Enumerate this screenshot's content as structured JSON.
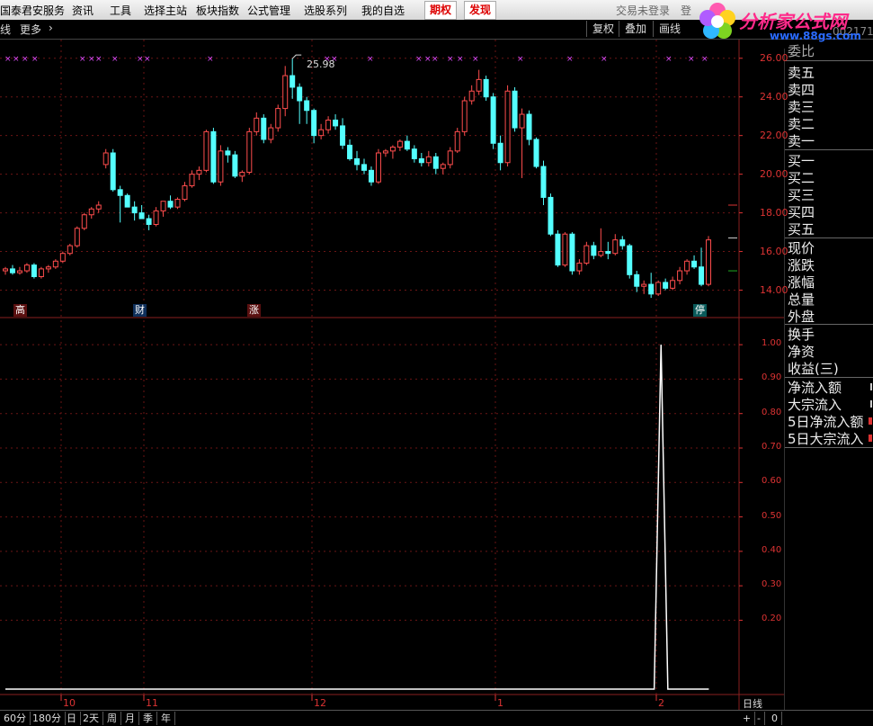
{
  "menu": {
    "items": [
      "国泰君安服务",
      "资讯",
      "工具",
      "选择主站",
      "板块指数",
      "公式管理",
      "选股系列",
      "我的自选"
    ],
    "hot_buttons": [
      "期权",
      "发现"
    ],
    "login_status": "交易未登录",
    "extra": "登"
  },
  "logo": {
    "title": "分析家公式网",
    "url": "www.88gs.com"
  },
  "toolbar": {
    "left_items": [
      "线",
      "更多"
    ],
    "buttons": [
      "复权",
      "叠加",
      "画线"
    ],
    "code": "002171"
  },
  "chart_data": [
    {
      "type": "candlestick",
      "title": "",
      "ylim": [
        13,
        26.5
      ],
      "y_ticks": [
        "26.00",
        "24.00",
        "22.00",
        "20.00",
        "18.00",
        "16.00",
        "14.00"
      ],
      "high_label": "25.98",
      "grid": true,
      "colors": {
        "up": "#ff4d4d",
        "down": "#54ffff"
      },
      "candles": [
        {
          "o": 15.0,
          "h": 15.2,
          "l": 14.8,
          "c": 15.1
        },
        {
          "o": 15.1,
          "h": 15.3,
          "l": 14.8,
          "c": 14.9
        },
        {
          "o": 14.9,
          "h": 15.2,
          "l": 14.8,
          "c": 15.0
        },
        {
          "o": 15.0,
          "h": 15.4,
          "l": 14.9,
          "c": 15.3
        },
        {
          "o": 15.3,
          "h": 15.4,
          "l": 14.6,
          "c": 14.7
        },
        {
          "o": 14.7,
          "h": 15.2,
          "l": 14.6,
          "c": 15.1
        },
        {
          "o": 15.1,
          "h": 15.3,
          "l": 14.9,
          "c": 15.2
        },
        {
          "o": 15.2,
          "h": 15.6,
          "l": 15.1,
          "c": 15.5
        },
        {
          "o": 15.5,
          "h": 16.0,
          "l": 15.4,
          "c": 15.9
        },
        {
          "o": 15.9,
          "h": 16.4,
          "l": 15.8,
          "c": 16.3
        },
        {
          "o": 16.3,
          "h": 17.3,
          "l": 16.2,
          "c": 17.2
        },
        {
          "o": 17.2,
          "h": 18.0,
          "l": 17.1,
          "c": 17.9
        },
        {
          "o": 17.9,
          "h": 18.3,
          "l": 17.7,
          "c": 18.2
        },
        {
          "o": 18.2,
          "h": 18.6,
          "l": 18.0,
          "c": 18.4
        },
        {
          "o": 20.5,
          "h": 21.3,
          "l": 20.3,
          "c": 21.1
        },
        {
          "o": 21.1,
          "h": 21.3,
          "l": 19.1,
          "c": 19.2
        },
        {
          "o": 19.2,
          "h": 19.4,
          "l": 17.5,
          "c": 18.9
        },
        {
          "o": 18.9,
          "h": 19.0,
          "l": 18.3,
          "c": 18.3
        },
        {
          "o": 18.3,
          "h": 18.6,
          "l": 17.6,
          "c": 18.0
        },
        {
          "o": 18.0,
          "h": 18.4,
          "l": 17.8,
          "c": 17.7
        },
        {
          "o": 17.7,
          "h": 17.9,
          "l": 17.1,
          "c": 17.4
        },
        {
          "o": 17.4,
          "h": 18.3,
          "l": 17.3,
          "c": 18.1
        },
        {
          "o": 18.1,
          "h": 18.6,
          "l": 17.8,
          "c": 18.6
        },
        {
          "o": 18.6,
          "h": 18.9,
          "l": 18.2,
          "c": 18.3
        },
        {
          "o": 18.3,
          "h": 18.8,
          "l": 18.2,
          "c": 18.7
        },
        {
          "o": 18.7,
          "h": 19.6,
          "l": 18.6,
          "c": 19.4
        },
        {
          "o": 19.4,
          "h": 20.2,
          "l": 19.3,
          "c": 20.0
        },
        {
          "o": 20.0,
          "h": 20.4,
          "l": 19.7,
          "c": 20.2
        },
        {
          "o": 20.2,
          "h": 22.3,
          "l": 20.1,
          "c": 22.2
        },
        {
          "o": 22.2,
          "h": 22.4,
          "l": 19.5,
          "c": 19.6
        },
        {
          "o": 19.6,
          "h": 21.5,
          "l": 19.4,
          "c": 21.2
        },
        {
          "o": 21.2,
          "h": 21.4,
          "l": 20.6,
          "c": 21.0
        },
        {
          "o": 21.0,
          "h": 21.2,
          "l": 19.8,
          "c": 19.9
        },
        {
          "o": 19.9,
          "h": 20.2,
          "l": 19.6,
          "c": 20.1
        },
        {
          "o": 20.1,
          "h": 22.4,
          "l": 20.0,
          "c": 22.2
        },
        {
          "o": 22.2,
          "h": 23.2,
          "l": 22.0,
          "c": 22.9
        },
        {
          "o": 22.9,
          "h": 23.1,
          "l": 21.6,
          "c": 21.8
        },
        {
          "o": 21.8,
          "h": 22.6,
          "l": 21.6,
          "c": 22.4
        },
        {
          "o": 22.4,
          "h": 23.6,
          "l": 22.2,
          "c": 23.4
        },
        {
          "o": 23.4,
          "h": 25.6,
          "l": 23.0,
          "c": 25.1
        },
        {
          "o": 25.1,
          "h": 25.98,
          "l": 23.9,
          "c": 24.5
        },
        {
          "o": 24.5,
          "h": 24.7,
          "l": 22.6,
          "c": 23.8
        },
        {
          "o": 23.8,
          "h": 24.0,
          "l": 22.6,
          "c": 23.3
        },
        {
          "o": 23.3,
          "h": 23.4,
          "l": 21.6,
          "c": 22.0
        },
        {
          "o": 22.0,
          "h": 22.6,
          "l": 21.8,
          "c": 22.3
        },
        {
          "o": 22.3,
          "h": 23.0,
          "l": 22.1,
          "c": 22.8
        },
        {
          "o": 22.8,
          "h": 23.1,
          "l": 22.3,
          "c": 22.5
        },
        {
          "o": 22.5,
          "h": 22.9,
          "l": 21.3,
          "c": 21.5
        },
        {
          "o": 21.5,
          "h": 21.8,
          "l": 20.7,
          "c": 20.8
        },
        {
          "o": 20.8,
          "h": 21.2,
          "l": 20.2,
          "c": 20.5
        },
        {
          "o": 20.5,
          "h": 20.8,
          "l": 20.0,
          "c": 20.2
        },
        {
          "o": 20.2,
          "h": 20.4,
          "l": 19.4,
          "c": 19.6
        },
        {
          "o": 19.6,
          "h": 21.3,
          "l": 19.5,
          "c": 21.1
        },
        {
          "o": 21.1,
          "h": 21.3,
          "l": 20.9,
          "c": 21.2
        },
        {
          "o": 21.2,
          "h": 21.5,
          "l": 20.8,
          "c": 21.4
        },
        {
          "o": 21.4,
          "h": 21.8,
          "l": 21.2,
          "c": 21.7
        },
        {
          "o": 21.7,
          "h": 22.0,
          "l": 21.2,
          "c": 21.3
        },
        {
          "o": 21.3,
          "h": 21.5,
          "l": 20.6,
          "c": 20.8
        },
        {
          "o": 20.8,
          "h": 21.1,
          "l": 20.4,
          "c": 20.6
        },
        {
          "o": 20.6,
          "h": 21.2,
          "l": 20.4,
          "c": 20.9
        },
        {
          "o": 20.9,
          "h": 21.1,
          "l": 20.0,
          "c": 20.3
        },
        {
          "o": 20.3,
          "h": 20.6,
          "l": 20.0,
          "c": 20.5
        },
        {
          "o": 20.5,
          "h": 21.4,
          "l": 20.3,
          "c": 21.2
        },
        {
          "o": 21.2,
          "h": 22.4,
          "l": 21.1,
          "c": 22.2
        },
        {
          "o": 22.2,
          "h": 24.0,
          "l": 22.0,
          "c": 23.8
        },
        {
          "o": 23.8,
          "h": 24.6,
          "l": 23.6,
          "c": 24.3
        },
        {
          "o": 24.3,
          "h": 25.4,
          "l": 24.1,
          "c": 24.9
        },
        {
          "o": 24.9,
          "h": 25.1,
          "l": 23.8,
          "c": 24.0
        },
        {
          "o": 24.0,
          "h": 24.2,
          "l": 21.3,
          "c": 21.6
        },
        {
          "o": 21.6,
          "h": 22.0,
          "l": 20.2,
          "c": 20.6
        },
        {
          "o": 20.6,
          "h": 24.6,
          "l": 20.4,
          "c": 24.3
        },
        {
          "o": 24.3,
          "h": 24.5,
          "l": 22.2,
          "c": 22.4
        },
        {
          "o": 22.4,
          "h": 23.4,
          "l": 19.8,
          "c": 23.1
        },
        {
          "o": 23.1,
          "h": 23.3,
          "l": 21.5,
          "c": 21.8
        },
        {
          "o": 21.8,
          "h": 21.9,
          "l": 20.3,
          "c": 20.4
        },
        {
          "o": 20.4,
          "h": 20.7,
          "l": 18.4,
          "c": 18.8
        },
        {
          "o": 18.8,
          "h": 19.0,
          "l": 16.8,
          "c": 16.9
        },
        {
          "o": 16.9,
          "h": 17.1,
          "l": 15.2,
          "c": 15.3
        },
        {
          "o": 15.3,
          "h": 17.0,
          "l": 15.2,
          "c": 16.9
        },
        {
          "o": 16.9,
          "h": 17.0,
          "l": 14.8,
          "c": 15.0
        },
        {
          "o": 15.0,
          "h": 15.6,
          "l": 14.8,
          "c": 15.4
        },
        {
          "o": 15.4,
          "h": 16.5,
          "l": 15.3,
          "c": 16.3
        },
        {
          "o": 16.3,
          "h": 16.5,
          "l": 15.6,
          "c": 15.8
        },
        {
          "o": 15.8,
          "h": 17.2,
          "l": 15.7,
          "c": 16.0
        },
        {
          "o": 16.0,
          "h": 16.5,
          "l": 15.6,
          "c": 15.9
        },
        {
          "o": 15.9,
          "h": 16.9,
          "l": 15.8,
          "c": 16.6
        },
        {
          "o": 16.6,
          "h": 16.8,
          "l": 16.1,
          "c": 16.3
        },
        {
          "o": 16.3,
          "h": 16.4,
          "l": 14.6,
          "c": 14.8
        },
        {
          "o": 14.8,
          "h": 15.0,
          "l": 13.9,
          "c": 14.2
        },
        {
          "o": 14.2,
          "h": 14.5,
          "l": 13.8,
          "c": 14.3
        },
        {
          "o": 14.3,
          "h": 14.9,
          "l": 13.6,
          "c": 13.8
        },
        {
          "o": 13.8,
          "h": 14.5,
          "l": 13.7,
          "c": 14.4
        },
        {
          "o": 14.4,
          "h": 14.6,
          "l": 14.0,
          "c": 14.1
        },
        {
          "o": 14.1,
          "h": 14.7,
          "l": 14.0,
          "c": 14.5
        },
        {
          "o": 14.5,
          "h": 15.2,
          "l": 14.3,
          "c": 15.0
        },
        {
          "o": 15.0,
          "h": 15.6,
          "l": 14.8,
          "c": 15.5
        },
        {
          "o": 15.5,
          "h": 15.8,
          "l": 15.1,
          "c": 15.2
        },
        {
          "o": 15.2,
          "h": 16.2,
          "l": 14.2,
          "c": 14.3
        },
        {
          "o": 14.3,
          "h": 16.8,
          "l": 14.2,
          "c": 16.6
        }
      ],
      "markers": [
        "高",
        "财",
        "涨",
        "停"
      ]
    },
    {
      "type": "line",
      "title": "",
      "ylim": [
        0,
        1.05
      ],
      "y_ticks": [
        "1.00",
        "0.90",
        "0.80",
        "0.70",
        "0.60",
        "0.50",
        "0.40",
        "0.30",
        "0.20"
      ],
      "x_ticks": [
        "10",
        "11",
        "12",
        "1",
        "2"
      ],
      "series": [
        {
          "values": [
            0,
            0,
            0,
            0,
            0,
            0,
            0,
            0,
            0,
            0,
            0,
            0,
            0,
            0,
            0,
            0,
            0,
            0,
            0,
            0,
            0,
            0,
            0,
            0,
            0,
            0,
            0,
            0,
            0,
            0,
            0,
            0,
            0,
            0,
            0,
            0,
            0,
            0,
            0,
            0,
            0,
            0,
            0,
            0,
            0,
            0,
            0,
            0,
            0,
            0,
            0,
            0,
            0,
            0,
            0,
            0,
            0,
            0,
            0,
            0,
            0,
            0,
            0,
            0,
            0,
            0,
            0,
            0,
            0,
            0,
            0,
            0,
            0,
            0,
            0,
            0,
            0,
            0,
            0,
            0,
            0,
            0,
            0,
            0,
            0,
            0,
            0,
            0,
            0,
            0,
            0,
            0,
            0,
            0,
            0,
            0,
            1,
            0,
            0,
            0,
            0,
            0,
            0,
            0
          ]
        }
      ]
    }
  ],
  "right_panel": {
    "top_label": "委比",
    "sell": [
      "卖五",
      "卖四",
      "卖三",
      "卖二",
      "卖一"
    ],
    "buy": [
      "买一",
      "买二",
      "买三",
      "买四",
      "买五"
    ],
    "stats": [
      "现价",
      "涨跌",
      "涨幅",
      "总量",
      "外盘"
    ],
    "stats2": [
      "换手",
      "净资",
      "收益(三)"
    ],
    "flows": [
      "净流入额",
      "大宗流入",
      "5日净流入额",
      "5日大宗流入"
    ]
  },
  "bottom": {
    "periods": [
      "60分",
      "180分",
      "日",
      "2天",
      "周",
      "月",
      "季",
      "年"
    ],
    "period_label": "日线",
    "zoom": [
      "+",
      "-",
      "0"
    ]
  }
}
